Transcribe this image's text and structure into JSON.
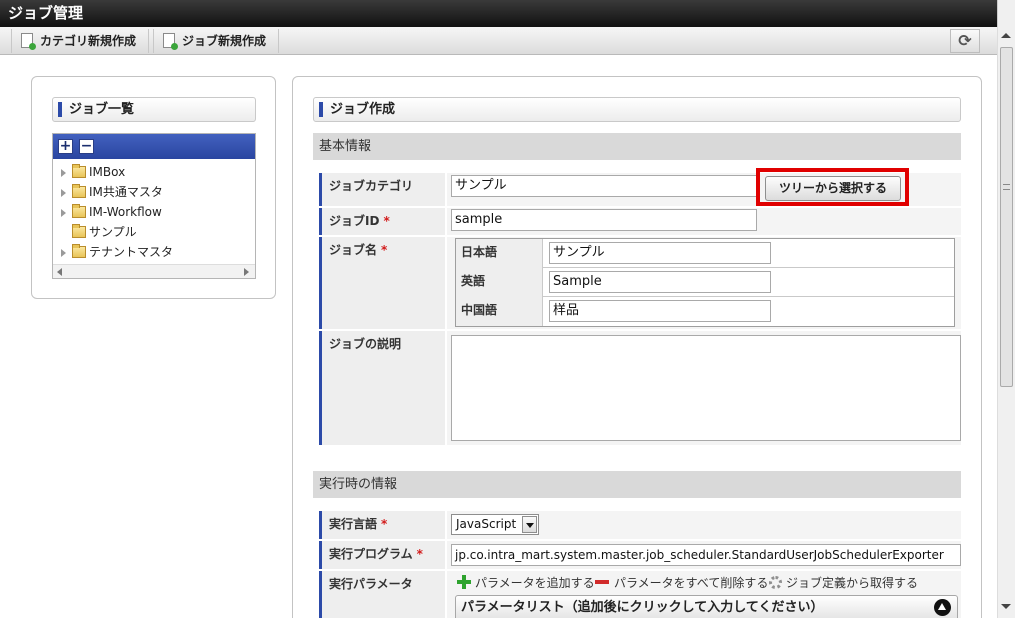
{
  "window": {
    "title": "ジョブ管理"
  },
  "toolbar": {
    "new_category_label": "カテゴリ新規作成",
    "new_job_label": "ジョブ新規作成",
    "refresh_icon": "refresh-icon"
  },
  "job_list": {
    "title": "ジョブ一覧",
    "expand_all_symbol": "+",
    "collapse_all_symbol": "−",
    "tree": [
      {
        "label": "IMBox",
        "expandable": true
      },
      {
        "label": "IM共通マスタ",
        "expandable": true
      },
      {
        "label": "IM-Workflow",
        "expandable": true
      },
      {
        "label": "サンプル",
        "expandable": false
      },
      {
        "label": "テナントマスタ",
        "expandable": true
      }
    ]
  },
  "job_create": {
    "title": "ジョブ作成",
    "basic_section": "基本情報",
    "category": {
      "label": "ジョブカテゴリ",
      "value": "サンプル",
      "button": "ツリーから選択する"
    },
    "job_id": {
      "label": "ジョブID",
      "required_mark": "*",
      "value": "sample"
    },
    "job_name": {
      "label": "ジョブ名",
      "required_mark": "*",
      "locales": [
        {
          "label": "日本語",
          "value": "サンプル"
        },
        {
          "label": "英語",
          "value": "Sample"
        },
        {
          "label": "中国語",
          "value": "样品"
        }
      ]
    },
    "description": {
      "label": "ジョブの説明",
      "value": ""
    },
    "runtime_section": "実行時の情報",
    "language": {
      "label": "実行言語",
      "required_mark": "*",
      "value": "JavaScript"
    },
    "program": {
      "label": "実行プログラム",
      "required_mark": "*",
      "value": "jp.co.intra_mart.system.master.job_scheduler.StandardUserJobSchedulerExporter"
    },
    "parameters": {
      "label": "実行パラメータ",
      "add": "パラメータを追加する",
      "delete_all": "パラメータをすべて削除する",
      "load_from_definition": "ジョブ定義から取得する",
      "list_title": "パラメータリスト（追加後にクリックして入力してください）"
    }
  },
  "colors": {
    "accent_blue": "#2c4aa8",
    "highlight_red": "#e00000",
    "required_red": "#d21b1b"
  }
}
